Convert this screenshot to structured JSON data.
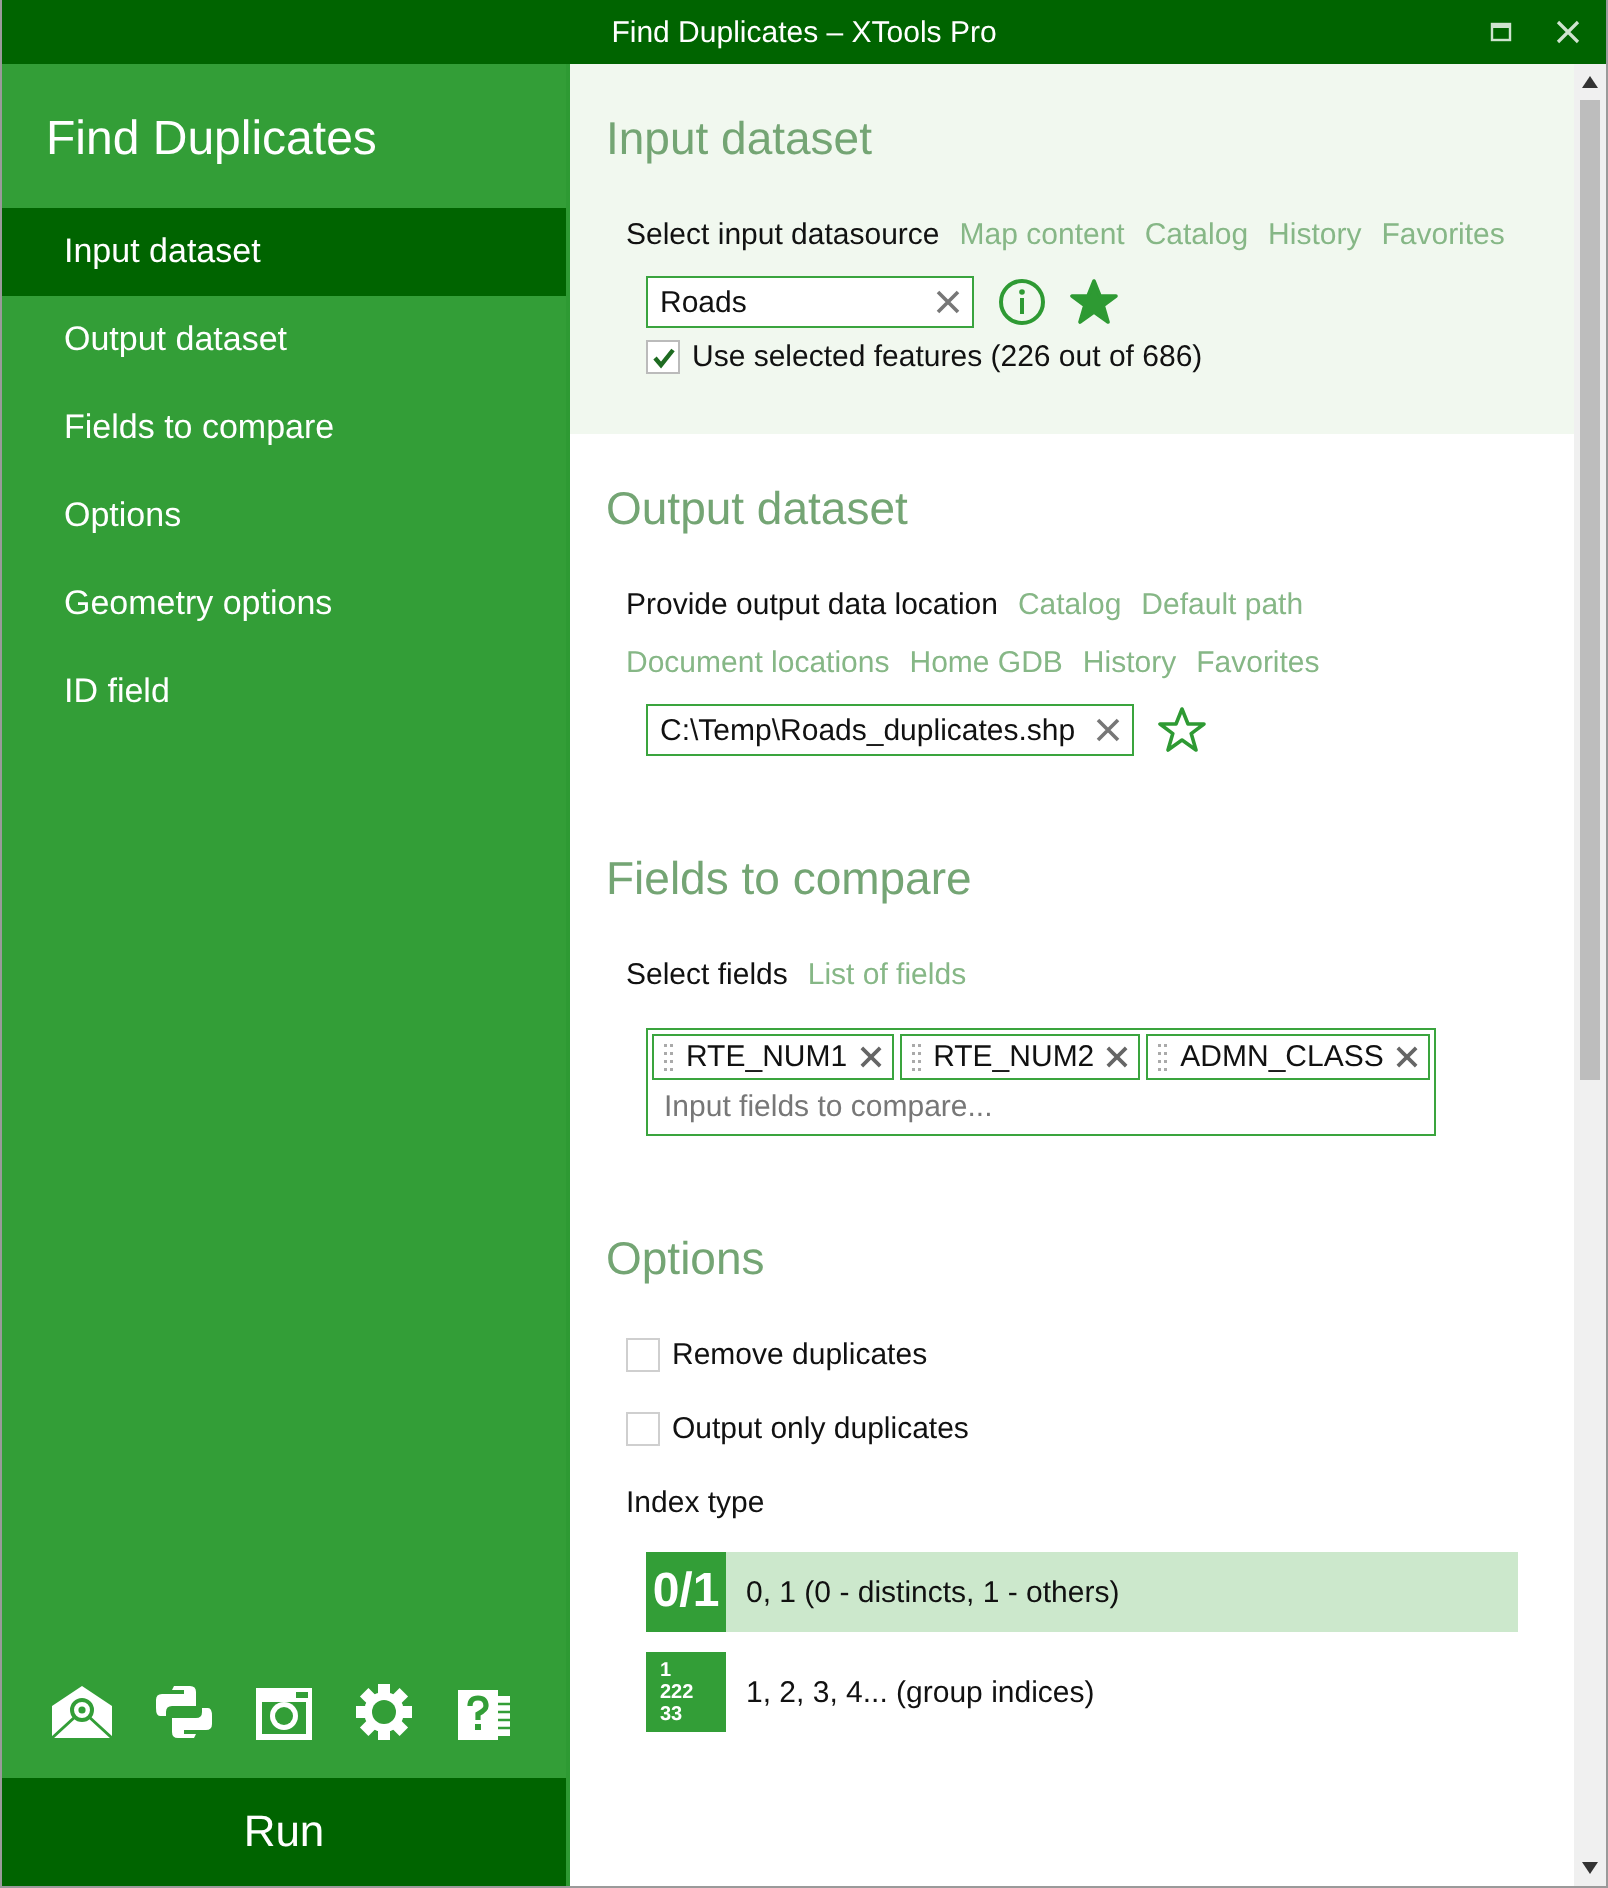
{
  "window": {
    "title": "Find Duplicates – XTools Pro"
  },
  "sidebar": {
    "title": "Find Duplicates",
    "items": [
      {
        "label": "Input dataset",
        "selected": true
      },
      {
        "label": "Output dataset",
        "selected": false
      },
      {
        "label": "Fields to compare",
        "selected": false
      },
      {
        "label": "Options",
        "selected": false
      },
      {
        "label": "Geometry options",
        "selected": false
      },
      {
        "label": "ID field",
        "selected": false
      }
    ],
    "run_button": "Run"
  },
  "input_dataset": {
    "heading": "Input dataset",
    "prompt": "Select input datasource",
    "links": [
      "Map content",
      "Catalog",
      "History",
      "Favorites"
    ],
    "value": "Roads",
    "favorite": true,
    "use_selected": {
      "label": "Use selected features (226 out of 686)",
      "checked": true
    }
  },
  "output_dataset": {
    "heading": "Output dataset",
    "prompt": "Provide output data location",
    "links": [
      "Catalog",
      "Default path",
      "Document locations",
      "Home GDB",
      "History",
      "Favorites"
    ],
    "value": "C:\\Temp\\Roads_duplicates.shp",
    "favorite": false
  },
  "fields_to_compare": {
    "heading": "Fields to compare",
    "prompt": "Select fields",
    "links": [
      "List of fields"
    ],
    "tags": [
      "RTE_NUM1",
      "RTE_NUM2",
      "ADMN_CLASS"
    ],
    "placeholder": "Input fields to compare..."
  },
  "options": {
    "heading": "Options",
    "checkboxes": [
      {
        "label": "Remove duplicates",
        "checked": false
      },
      {
        "label": "Output only duplicates",
        "checked": false
      }
    ],
    "index_type_label": "Index type",
    "index_types": [
      {
        "badge": [
          "0/1"
        ],
        "label": "0, 1 (0 - distincts, 1 - others)",
        "selected": true
      },
      {
        "badge": [
          "1",
          "222",
          "33"
        ],
        "label": "1, 2, 3, 4... (group indices)",
        "selected": false
      }
    ]
  }
}
